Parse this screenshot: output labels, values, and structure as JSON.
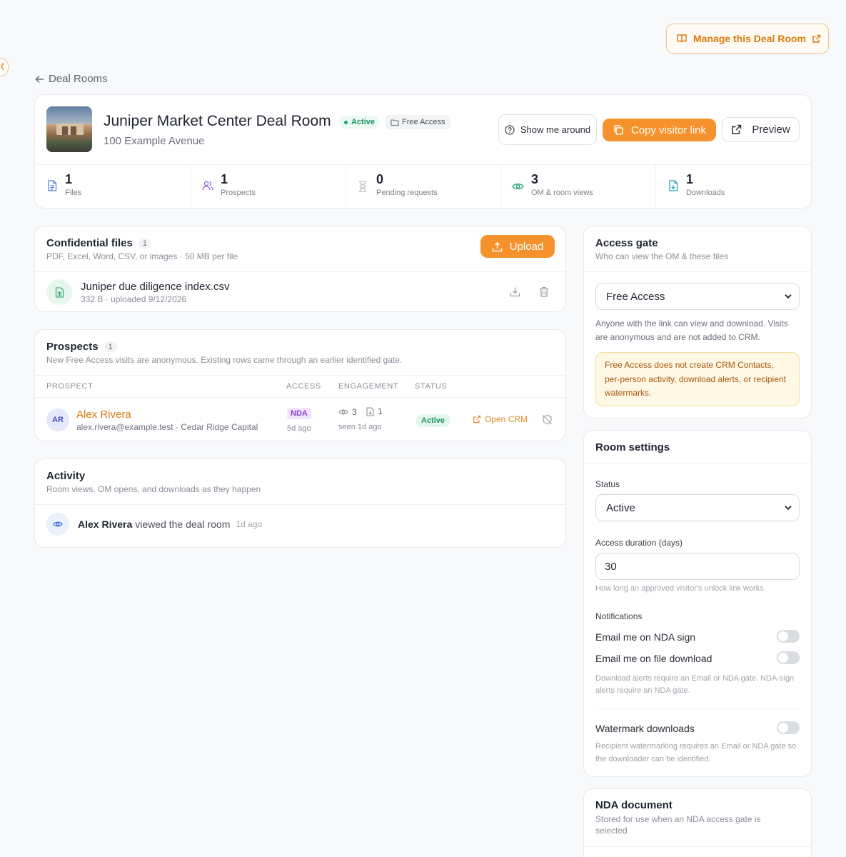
{
  "header": {
    "manage_label": "Manage this Deal Room",
    "back_label": "Deal Rooms"
  },
  "room": {
    "title": "Juniper Market Center Deal Room",
    "address": "100 Example Avenue",
    "status_badge": "Active",
    "access_badge": "Free Access",
    "show_around_label": "Show me around",
    "copy_link_label": "Copy visitor link",
    "preview_label": "Preview"
  },
  "stats": [
    {
      "value": "1",
      "label": "Files",
      "icon": "file-icon"
    },
    {
      "value": "1",
      "label": "Prospects",
      "icon": "users-icon"
    },
    {
      "value": "0",
      "label": "Pending requests",
      "icon": "hourglass-icon"
    },
    {
      "value": "3",
      "label": "OM & room views",
      "icon": "eye-icon"
    },
    {
      "value": "1",
      "label": "Downloads",
      "icon": "download-file-icon"
    }
  ],
  "files": {
    "title": "Confidential files",
    "count": "1",
    "subtitle": "PDF, Excel, Word, CSV, or images · 50 MB per file",
    "upload_label": "Upload",
    "items": [
      {
        "name": "Juniper due diligence index.csv",
        "meta": "332 B · uploaded 9/12/2026"
      }
    ]
  },
  "prospects": {
    "title": "Prospects",
    "count": "1",
    "subtitle": "New Free Access visits are anonymous. Existing rows came through an earlier identified gate.",
    "columns": [
      "PROSPECT",
      "ACCESS",
      "ENGAGEMENT",
      "STATUS"
    ],
    "rows": [
      {
        "initials": "AR",
        "name": "Alex Rivera",
        "detail": "alex.rivera@example.test · Cedar Ridge Capital",
        "access": "NDA",
        "access_time": "5d ago",
        "views": "3",
        "downloads": "1",
        "seen": "seen 1d ago",
        "status": "Active",
        "crm_label": "Open CRM"
      }
    ]
  },
  "activity": {
    "title": "Activity",
    "subtitle": "Room views, OM opens, and downloads as they happen",
    "items": [
      {
        "actor": "Alex Rivera",
        "action": "viewed the deal room",
        "time": "1d ago"
      }
    ]
  },
  "access_gate": {
    "title": "Access gate",
    "subtitle": "Who can view the OM & these files",
    "selected": "Free Access",
    "description": "Anyone with the link can view and download. Visits are anonymous and are not added to CRM.",
    "warning": "Free Access does not create CRM Contacts, per-person activity, download alerts, or recipient watermarks."
  },
  "settings": {
    "title": "Room settings",
    "status_label": "Status",
    "status_value": "Active",
    "duration_label": "Access duration (days)",
    "duration_value": "30",
    "duration_help": "How long an approved visitor's unlock link works.",
    "notifications_label": "Notifications",
    "notify_nda": "Email me on NDA sign",
    "notify_download": "Email me on file download",
    "notify_help": "Download alerts require an Email or NDA gate. NDA-sign alerts require an NDA gate.",
    "watermark_label": "Watermark downloads",
    "watermark_help": "Recipient watermarking requires an Email or NDA gate so the downloader can be identified."
  },
  "nda": {
    "title": "NDA document",
    "subtitle": "Stored for use when an NDA access gate is selected"
  },
  "colors": {
    "accent": "#f5922b",
    "active_green": "#1ea672",
    "nda_purple": "#8b3fd1"
  }
}
